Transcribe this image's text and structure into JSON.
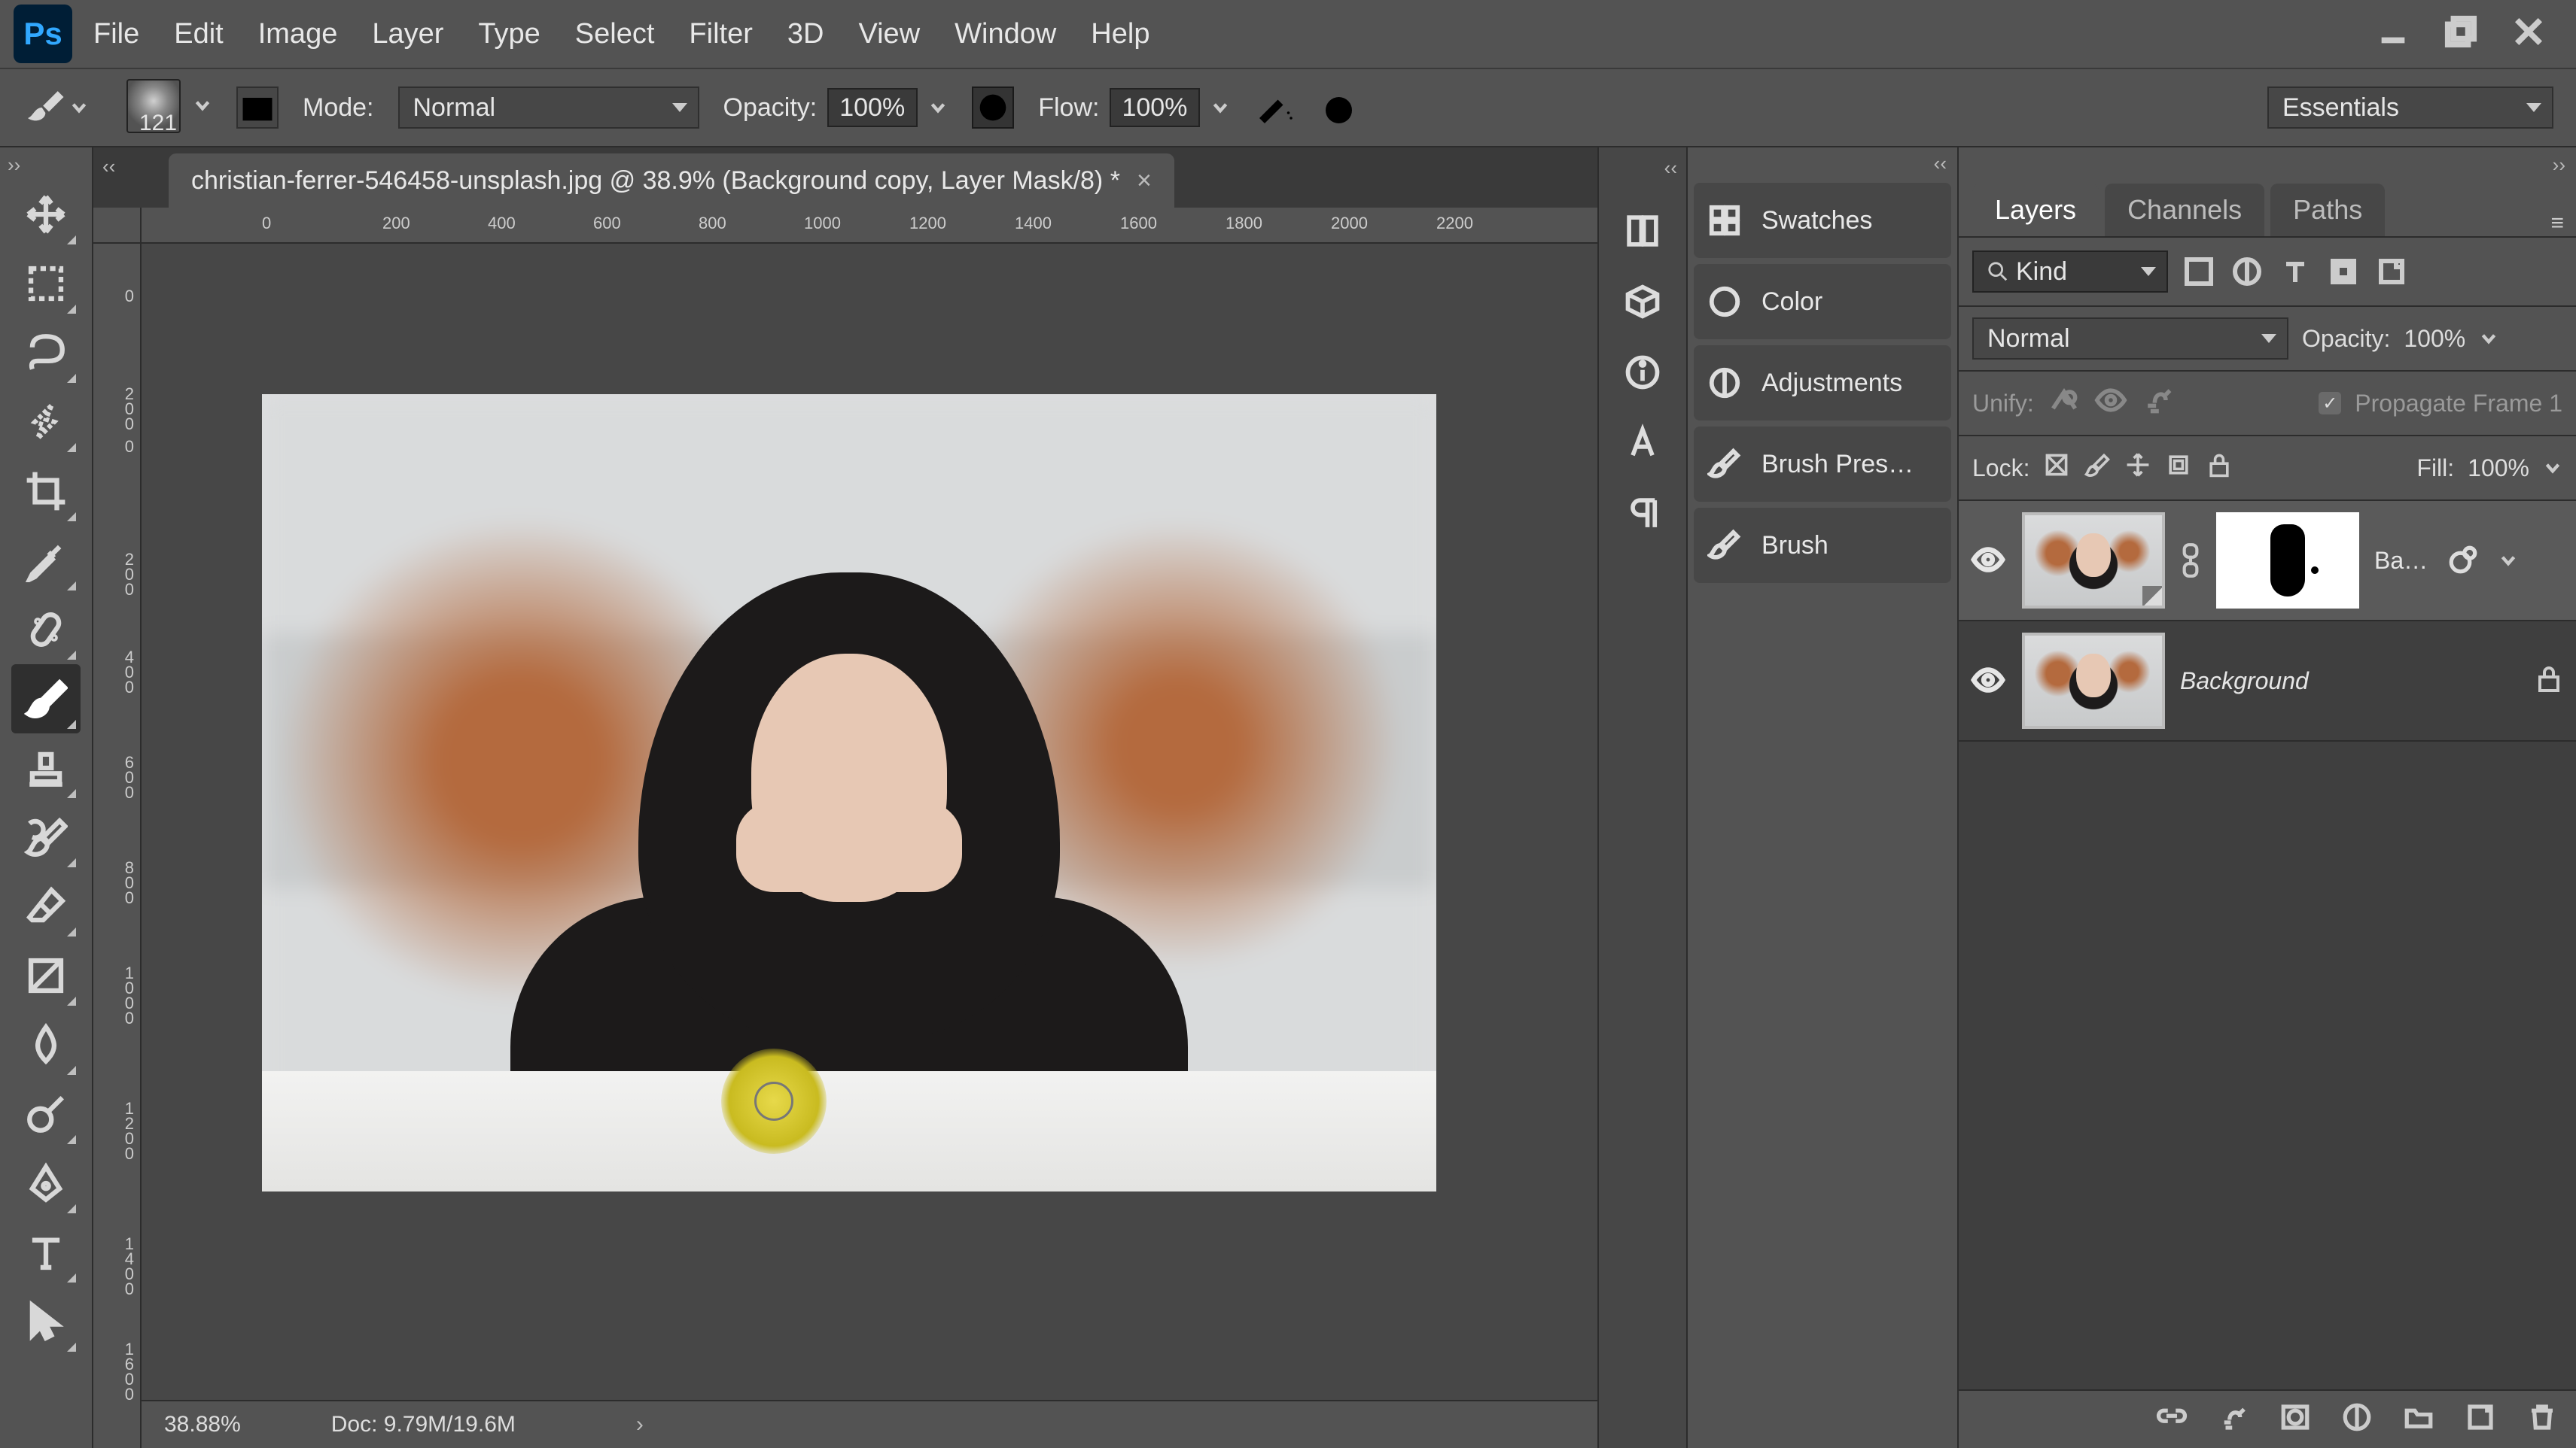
{
  "menu": {
    "items": [
      "File",
      "Edit",
      "Image",
      "Layer",
      "Type",
      "Select",
      "Filter",
      "3D",
      "View",
      "Window",
      "Help"
    ]
  },
  "options": {
    "brush_size": "121",
    "mode_label": "Mode:",
    "mode_value": "Normal",
    "opacity_label": "Opacity:",
    "opacity_value": "100%",
    "flow_label": "Flow:",
    "flow_value": "100%",
    "workspace": "Essentials"
  },
  "document": {
    "tab_title": "christian-ferrer-546458-unsplash.jpg @ 38.9% (Background copy, Layer Mask/8) *"
  },
  "hruler_ticks": [
    {
      "pos": 160,
      "label": "0"
    },
    {
      "pos": 320,
      "label": "200"
    },
    {
      "pos": 460,
      "label": "400"
    },
    {
      "pos": 600,
      "label": "600"
    },
    {
      "pos": 740,
      "label": "800"
    },
    {
      "pos": 880,
      "label": "1000"
    },
    {
      "pos": 1020,
      "label": "1200"
    },
    {
      "pos": 1160,
      "label": "1400"
    },
    {
      "pos": 1300,
      "label": "1600"
    },
    {
      "pos": 1440,
      "label": "1800"
    },
    {
      "pos": 1580,
      "label": "2000"
    },
    {
      "pos": 1720,
      "label": "2200"
    }
  ],
  "vruler_ticks": [
    {
      "pos": 60,
      "label": "0"
    },
    {
      "pos": 190,
      "label": "2\n0\n0"
    },
    {
      "pos": 260,
      "label": "0"
    },
    {
      "pos": 410,
      "label": "2\n0\n0"
    },
    {
      "pos": 540,
      "label": "4\n0\n0"
    },
    {
      "pos": 680,
      "label": "6\n0\n0"
    },
    {
      "pos": 820,
      "label": "8\n0\n0"
    },
    {
      "pos": 960,
      "label": "1\n0\n0\n0"
    },
    {
      "pos": 1140,
      "label": "1\n2\n0\n0"
    },
    {
      "pos": 1320,
      "label": "1\n4\n0\n0"
    },
    {
      "pos": 1460,
      "label": "1\n6\n0\n0"
    }
  ],
  "status": {
    "zoom": "38.88%",
    "doc": "Doc: 9.79M/19.6M"
  },
  "panels": {
    "list": [
      "Swatches",
      "Color",
      "Adjustments",
      "Brush Pres…",
      "Brush"
    ]
  },
  "layers_panel": {
    "tabs": [
      "Layers",
      "Channels",
      "Paths"
    ],
    "filter_kind": "Kind",
    "blend_mode": "Normal",
    "opacity_label": "Opacity:",
    "opacity_value": "100%",
    "unify_label": "Unify:",
    "propagate_label": "Propagate Frame 1",
    "lock_label": "Lock:",
    "fill_label": "Fill:",
    "fill_value": "100%",
    "layers": [
      {
        "name": "Ba…",
        "smart": true,
        "selected": true,
        "has_mask": true
      },
      {
        "name": "Background",
        "locked": true,
        "italic": true
      }
    ]
  }
}
